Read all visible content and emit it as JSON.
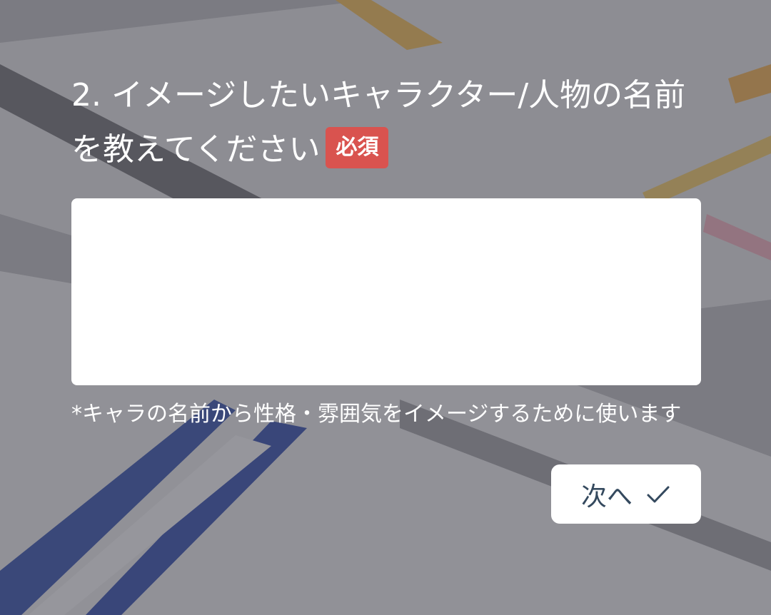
{
  "question": {
    "text": "2. イメージしたいキャラクター/人物の名前を教えてください",
    "required_badge": "必須"
  },
  "answer_input": {
    "value": "",
    "placeholder": ""
  },
  "hint": "*キャラの名前から性格・雰囲気をイメージするために使います",
  "next_button": {
    "label": "次へ",
    "icon": "check-icon"
  },
  "colors": {
    "badge": "#d9534f",
    "button_text": "#34495e",
    "overlay": "#46464e"
  }
}
